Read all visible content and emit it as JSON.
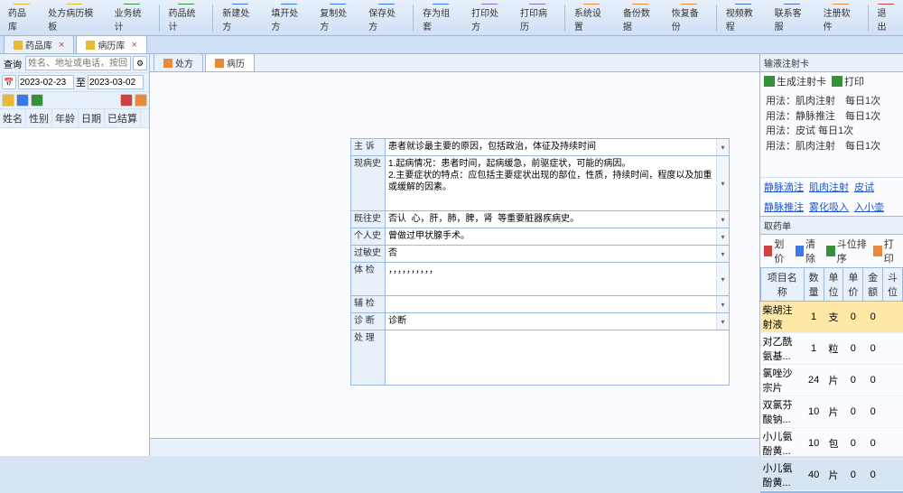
{
  "toolbar": {
    "items": [
      {
        "label": "药品库",
        "icon": "#e8b838"
      },
      {
        "label": "处方病历模板",
        "icon": "#e8b838"
      },
      {
        "label": "业务统计",
        "icon": "#3a8e3a"
      },
      {
        "label": "药品统计",
        "icon": "#3a8e3a"
      },
      {
        "label": "新建处方",
        "icon": "#3a78e8"
      },
      {
        "label": "填开处方",
        "icon": "#3a78e8"
      },
      {
        "label": "复制处方",
        "icon": "#3a78e8"
      },
      {
        "label": "保存处方",
        "icon": "#3a78e8"
      },
      {
        "label": "存为组套",
        "icon": "#3a78e8"
      },
      {
        "label": "打印处方",
        "icon": "#8a6ed8"
      },
      {
        "label": "打印病历",
        "icon": "#8a6ed8"
      },
      {
        "label": "系统设置",
        "icon": "#e88a3a"
      },
      {
        "label": "备份数据",
        "icon": "#e88a3a"
      },
      {
        "label": "恢复备份",
        "icon": "#e88a3a"
      },
      {
        "label": "视频教程",
        "icon": "#4a6acc"
      },
      {
        "label": "联系客服",
        "icon": "#4a6acc"
      },
      {
        "label": "注册软件",
        "icon": "#e88a3a"
      },
      {
        "label": "退出",
        "icon": "#d04040"
      }
    ]
  },
  "mainTabs": {
    "left": [
      {
        "label": "药品库",
        "active": false
      },
      {
        "label": "病历库",
        "active": true
      }
    ]
  },
  "leftPanel": {
    "searchLabel": "查询",
    "searchPlaceholder": "姓名、地址或电话，按回车查询",
    "dates": {
      "from": "2023-02-23",
      "to": "2023-03-02",
      "toLabel": "至"
    },
    "headers": [
      "姓名",
      "性别",
      "年龄",
      "日期",
      "已结算"
    ]
  },
  "centerTabs": [
    {
      "label": "处方",
      "active": false
    },
    {
      "label": "病历",
      "active": true
    }
  ],
  "form": {
    "rows": [
      {
        "label": "主  诉",
        "value": "患者就诊最主要的原因，包括政治，体征及持续时间",
        "h": 18,
        "dd": true
      },
      {
        "label": "现病史",
        "value": "1.起病情况：患者时间，起病缓急，前驱症状，可能的病因。\n2.主要症状的特点：应包括主要症状出现的部位，性质，持续时间，程度以及加重或缓解的因素。",
        "h": 60,
        "dd": true
      },
      {
        "label": "既往史",
        "value": "否认  心，肝，肺，脾，肾  等重要脏器疾病史。",
        "h": 18,
        "dd": true
      },
      {
        "label": "个人史",
        "value": "曾做过甲状腺手术。",
        "h": 18,
        "dd": true
      },
      {
        "label": "过敏史",
        "value": "否",
        "h": 18,
        "dd": true
      },
      {
        "label": "体  检",
        "value": "，，，，，，，，，，",
        "h": 36,
        "dd": true
      },
      {
        "label": "辅  检",
        "value": "",
        "h": 18,
        "dd": true
      },
      {
        "label": "诊  断",
        "value": "诊断",
        "h": 18,
        "dd": true
      },
      {
        "label": "处  理",
        "value": "",
        "h": 60,
        "dd": false
      }
    ]
  },
  "rightPanel": {
    "cardTitle": "输液注射卡",
    "cardTools": [
      "生成注射卡",
      "打印"
    ],
    "usage": [
      "用法：肌肉注射　每日1次",
      "用法：静脉推注　每日1次",
      "用法：皮试  每日1次",
      "用法：肌肉注射　每日1次"
    ],
    "navLinks": [
      "静脉滴注",
      "肌肉注射",
      "皮试",
      "静脉推注",
      "雾化吸入",
      "入小壶"
    ],
    "medTitle": "取药单",
    "medTools": [
      "划价",
      "清除",
      "斗位排序",
      "打印"
    ],
    "medHeaders": [
      "项目名称",
      "数量",
      "单位",
      "单价",
      "金额",
      "斗位"
    ],
    "medRows": [
      {
        "name": "柴胡注射液",
        "qty": 1,
        "unit": "支",
        "price": 0,
        "amt": 0,
        "pos": "",
        "sel": true
      },
      {
        "name": "对乙酰氨基...",
        "qty": 1,
        "unit": "粒",
        "price": 0,
        "amt": 0,
        "pos": ""
      },
      {
        "name": "氯唑沙宗片",
        "qty": 24,
        "unit": "片",
        "price": 0,
        "amt": 0,
        "pos": ""
      },
      {
        "name": "双氯芬酸钠...",
        "qty": 10,
        "unit": "片",
        "price": 0,
        "amt": 0,
        "pos": ""
      },
      {
        "name": "小儿氨酚黄...",
        "qty": 10,
        "unit": "包",
        "price": 0,
        "amt": 0,
        "pos": ""
      },
      {
        "name": "小儿氨酚黄...",
        "qty": 40,
        "unit": "片",
        "price": 0,
        "amt": 0,
        "pos": ""
      }
    ]
  }
}
